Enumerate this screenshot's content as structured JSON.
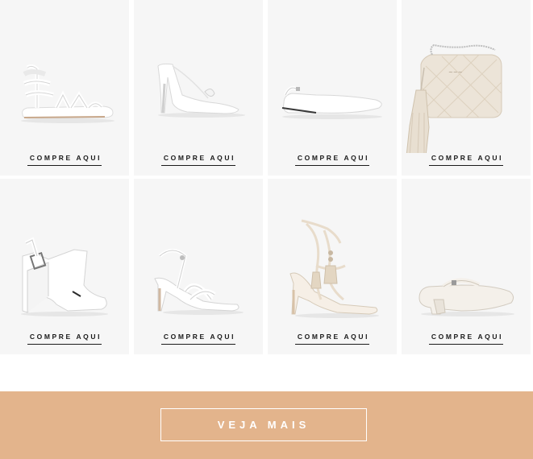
{
  "products": [
    {
      "name": "sandalia-rasteira",
      "cta": "COMPRE AQUI"
    },
    {
      "name": "mule-salto-fino",
      "cta": "COMPRE AQUI"
    },
    {
      "name": "slingback-bico-fino",
      "cta": "COMPRE AQUI"
    },
    {
      "name": "bolsa-matelasse",
      "cta": "COMPRE AQUI"
    },
    {
      "name": "sandalia-anabela",
      "cta": "COMPRE AQUI"
    },
    {
      "name": "sandalia-salto-fino",
      "cta": "COMPRE AQUI"
    },
    {
      "name": "sandalia-amarracao",
      "cta": "COMPRE AQUI"
    },
    {
      "name": "mule-salto-bloco",
      "cta": "COMPRE AQUI"
    }
  ],
  "more_button": {
    "label": "VEJA MAIS"
  },
  "colors": {
    "banner": "#e3b48c",
    "card": "#f6f6f6",
    "product_white": "#ffffff",
    "product_cream": "#ece4d8"
  }
}
